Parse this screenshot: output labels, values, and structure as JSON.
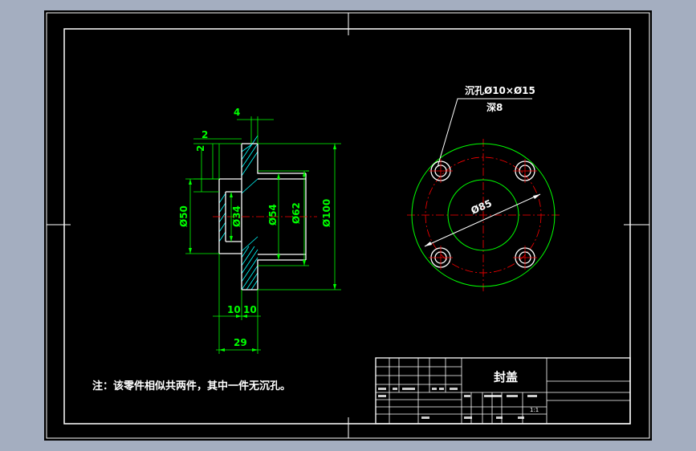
{
  "drawing": {
    "front_view": {
      "dims": {
        "d4": "4",
        "d2a": "2",
        "d2b": "2",
        "dia50": "Ø50",
        "dia34": "Ø34",
        "dia54": "Ø54",
        "dia62": "Ø62",
        "dia100": "Ø100",
        "len10a": "10",
        "len10b": "10",
        "len29": "29"
      }
    },
    "top_view": {
      "callout_line1": "沉孔Ø10×Ø15",
      "callout_line2": "深8",
      "dia85": "Ø85"
    },
    "note": "注：该零件相似共两件，其中一件无沉孔。",
    "title_block": {
      "part_name": "封盖",
      "scale": "1:1"
    }
  },
  "colors": {
    "background": "#a4aec0",
    "sheet": "#000000",
    "outline": "#ffffff",
    "dimension": "#00ff00",
    "centerline": "#ff0000",
    "hidden": "#ffff00",
    "hatch": "#00ffff"
  }
}
